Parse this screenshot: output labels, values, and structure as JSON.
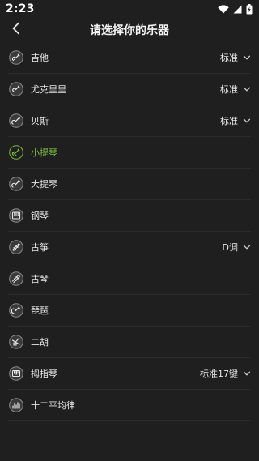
{
  "status": {
    "time": "2:23"
  },
  "header": {
    "title": "请选择你的乐器"
  },
  "instruments": [
    {
      "name": "吉他",
      "tuning": "标准",
      "icon": "guitar-icon"
    },
    {
      "name": "尤克里里",
      "tuning": "标准",
      "icon": "ukulele-icon"
    },
    {
      "name": "贝斯",
      "tuning": "标准",
      "icon": "bass-icon"
    },
    {
      "name": "小提琴",
      "tuning": "",
      "icon": "violin-icon",
      "selected": true
    },
    {
      "name": "大提琴",
      "tuning": "",
      "icon": "cello-icon"
    },
    {
      "name": "钢琴",
      "tuning": "",
      "icon": "piano-icon"
    },
    {
      "name": "古筝",
      "tuning": "D调",
      "icon": "guzheng-icon"
    },
    {
      "name": "古琴",
      "tuning": "",
      "icon": "guqin-icon"
    },
    {
      "name": "琵琶",
      "tuning": "",
      "icon": "pipa-icon"
    },
    {
      "name": "二胡",
      "tuning": "",
      "icon": "erhu-icon"
    },
    {
      "name": "拇指琴",
      "tuning": "标准17键",
      "icon": "kalimba-icon"
    },
    {
      "name": "十二平均律",
      "tuning": "",
      "icon": "equal-temperament-icon"
    }
  ],
  "colors": {
    "accent": "#78b83e",
    "background": "#1f1f1f",
    "icon_fill": "#3a3a3a"
  }
}
